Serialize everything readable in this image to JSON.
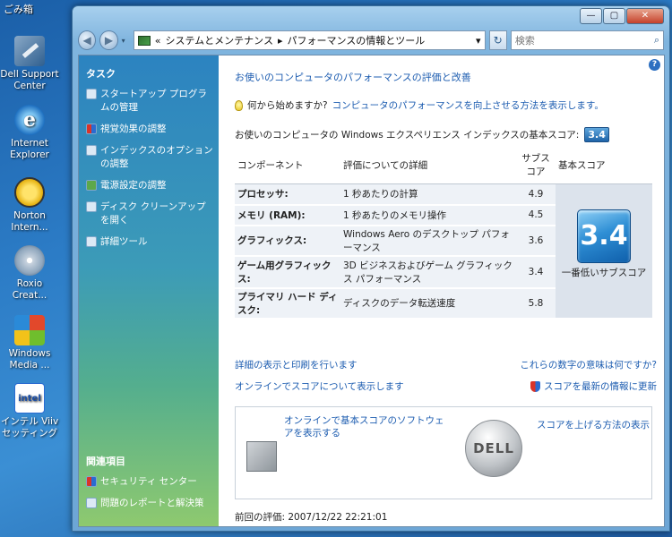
{
  "desktop": {
    "top_label": "ごみ箱",
    "icons": [
      {
        "label": "Dell Support Center"
      },
      {
        "label": "Internet Explorer"
      },
      {
        "label": "Norton Intern..."
      },
      {
        "label": "Roxio Creat..."
      },
      {
        "label": "Windows Media ..."
      },
      {
        "label": "インテル Viiv セッティング"
      }
    ]
  },
  "window": {
    "controls": {
      "min": "—",
      "max": "▢",
      "close": "✕"
    },
    "nav": {
      "back": "◀",
      "forward": "▶",
      "breadcrumb_prefix": "«",
      "crumb1": "システムとメンテナンス",
      "sep": "▸",
      "crumb2": "パフォーマンスの情報とツール",
      "dropdown": "▾",
      "refresh": "↻",
      "search_placeholder": "検索",
      "search_icon": "⌕"
    }
  },
  "sidebar": {
    "tasks_heading": "タスク",
    "tasks": [
      {
        "label": "スタートアップ プログラムの管理",
        "icon": "startup-icon"
      },
      {
        "label": "視覚効果の調整",
        "icon": "shield-icon"
      },
      {
        "label": "インデックスのオプションの調整",
        "icon": "index-icon"
      },
      {
        "label": "電源設定の調整",
        "icon": "power-icon"
      },
      {
        "label": "ディスク クリーンアップを開く",
        "icon": "disk-icon"
      },
      {
        "label": "詳細ツール",
        "icon": "tools-icon"
      }
    ],
    "related_heading": "関連項目",
    "related": [
      {
        "label": "セキュリティ センター",
        "icon": "security-icon"
      },
      {
        "label": "問題のレポートと解決策",
        "icon": "report-icon"
      }
    ]
  },
  "main": {
    "help": "?",
    "title": "お使いのコンピュータのパフォーマンスの評価と改善",
    "hint_prefix": "何から始めますか?",
    "hint_link": "コンピュータのパフォーマンスを向上させる方法を表示します。",
    "base_label": "お使いのコンピュータの Windows エクスペリエンス インデックスの基本スコア:",
    "base_score": "3.4",
    "table": {
      "headers": {
        "component": "コンポーネント",
        "detail": "評価についての詳細",
        "subscore": "サブスコア",
        "basescore": "基本スコア"
      },
      "rows": [
        {
          "name": "プロセッサ:",
          "detail": "1 秒あたりの計算",
          "score": "4.9"
        },
        {
          "name": "メモリ (RAM):",
          "detail": "1 秒あたりのメモリ操作",
          "score": "4.5"
        },
        {
          "name": "グラフィックス:",
          "detail": "Windows Aero のデスクトップ パフォーマンス",
          "score": "3.6"
        },
        {
          "name": "ゲーム用グラフィックス:",
          "detail": "3D ビジネスおよびゲーム グラフィックス パフォーマンス",
          "score": "3.4"
        },
        {
          "name": "プライマリ ハード ディスク:",
          "detail": "ディスクのデータ転送速度",
          "score": "5.8"
        }
      ],
      "big_score": "3.4",
      "big_caption": "一番低いサブスコア"
    },
    "links": {
      "print": "詳細の表示と印刷を行います",
      "meaning": "これらの数字の意味は何ですか?",
      "online": "オンラインでスコアについて表示します",
      "update": "スコアを最新の情報に更新"
    },
    "promo": {
      "software": "オンラインで基本スコアのソフトウェアを表示する",
      "dell": "DELL",
      "raise": "スコアを上げる方法の表示"
    },
    "last_eval": "前回の評価: 2007/12/22 22:21:01"
  }
}
